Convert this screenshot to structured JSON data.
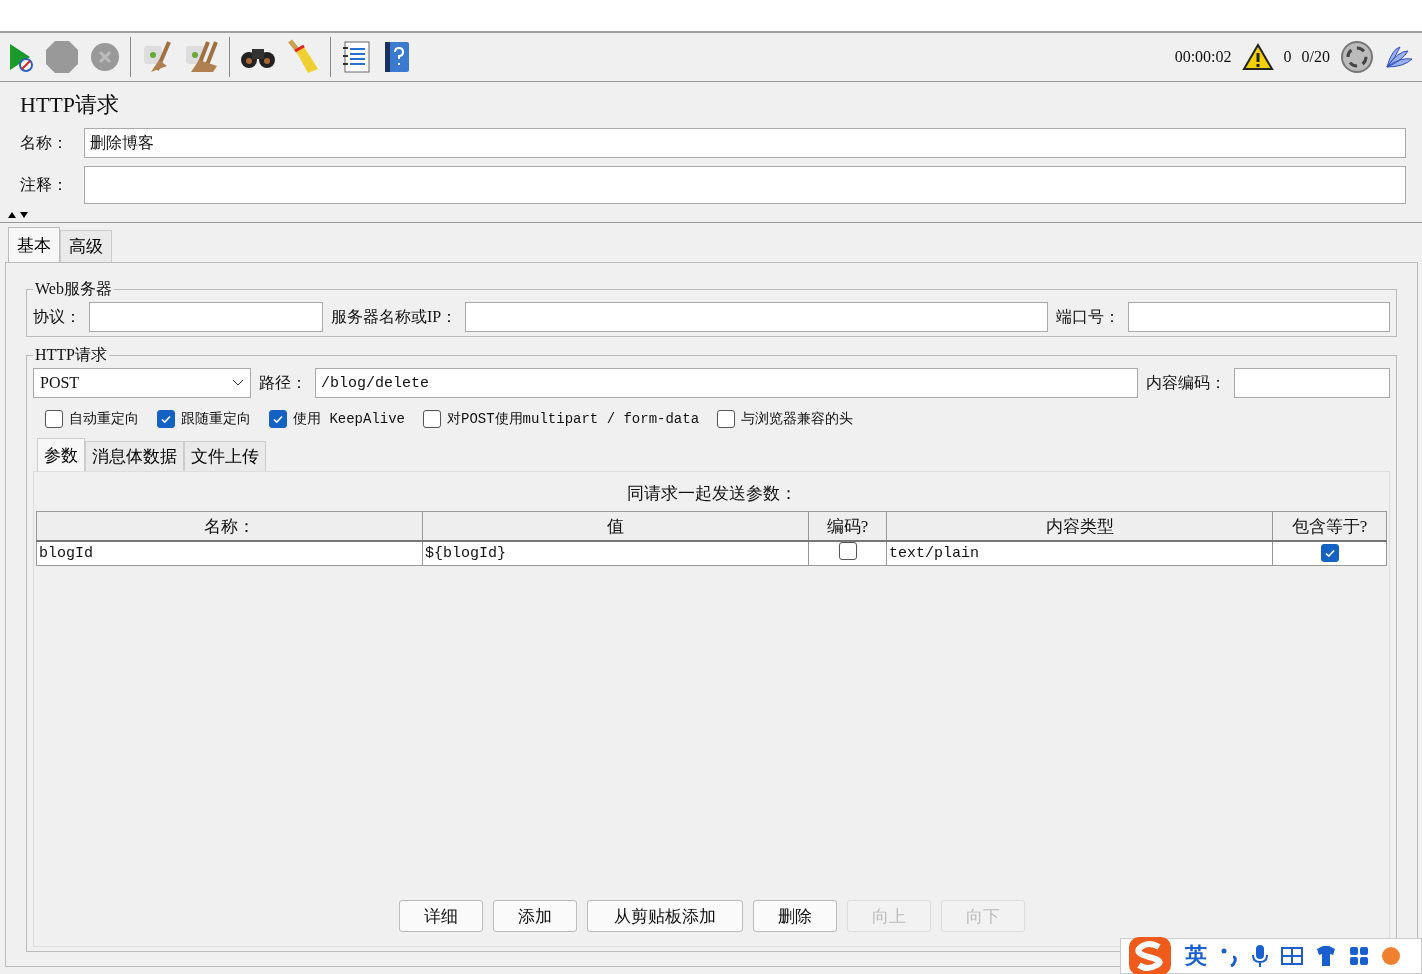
{
  "toolbar": {
    "timer": "00:00:02",
    "warnings": "0",
    "threads": "0/20"
  },
  "panel_title": "HTTP请求",
  "name_field": {
    "label": "名称：",
    "value": "删除博客"
  },
  "comment_field": {
    "label": "注释："
  },
  "tabs": [
    {
      "label": "基本",
      "selected": true
    },
    {
      "label": "高级",
      "selected": false
    }
  ],
  "web_server": {
    "title": "Web服务器",
    "fields": [
      {
        "label": "协议："
      },
      {
        "label": "服务器名称或IP："
      },
      {
        "label": "端口号："
      }
    ]
  },
  "http_request": {
    "title": "HTTP请求",
    "method": "POST",
    "path_label": "路径：",
    "path": "/blog/delete",
    "encoding_label": "内容编码：",
    "options": [
      {
        "label": "自动重定向",
        "checked": false
      },
      {
        "label": "跟随重定向",
        "checked": true
      },
      {
        "label": "使用 KeepAlive",
        "checked": true
      },
      {
        "label": "对POST使用multipart / form-data",
        "checked": false
      },
      {
        "label": "与浏览器兼容的头",
        "checked": false
      }
    ]
  },
  "sub_tabs": [
    {
      "label": "参数",
      "selected": true
    },
    {
      "label": "消息体数据",
      "selected": false
    },
    {
      "label": "文件上传",
      "selected": false
    }
  ],
  "params": {
    "caption": "同请求一起发送参数：",
    "columns": [
      "名称：",
      "值",
      "编码?",
      "内容类型",
      "包含等于?"
    ],
    "rows": [
      {
        "name": "blogId",
        "value": "${blogId}",
        "encode": false,
        "content_type": "text/plain",
        "include_equals": true
      }
    ]
  },
  "buttons": [
    {
      "label": "详细",
      "disabled": false
    },
    {
      "label": "添加",
      "disabled": false
    },
    {
      "label": "从剪贴板添加",
      "disabled": false
    },
    {
      "label": "删除",
      "disabled": false
    },
    {
      "label": "向上",
      "disabled": true
    },
    {
      "label": "向下",
      "disabled": true
    }
  ],
  "ime_bar": {
    "mode": "英"
  }
}
